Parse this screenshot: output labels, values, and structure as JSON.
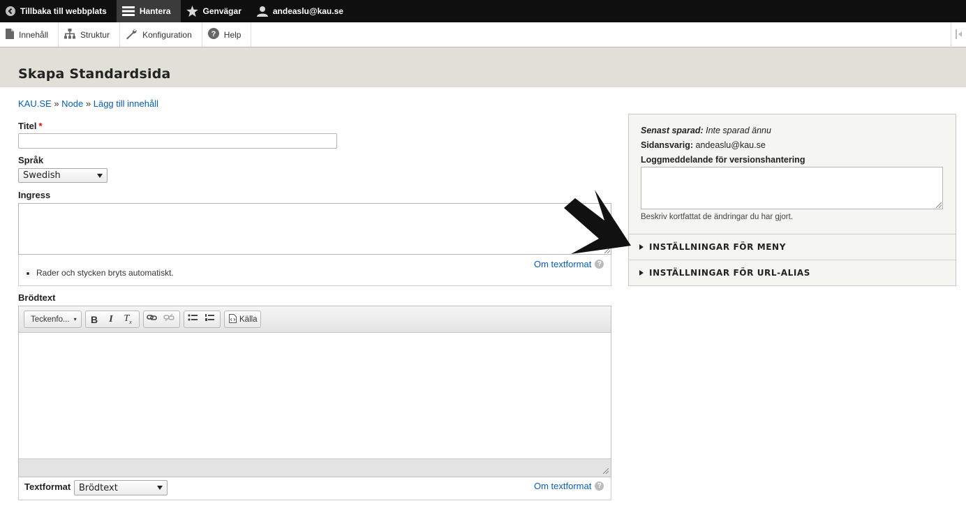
{
  "toolbar": {
    "back_label": "Tillbaka till webbplats",
    "manage_label": "Hantera",
    "shortcuts_label": "Genvägar",
    "user_label": "andeaslu@kau.se"
  },
  "tray": {
    "items": [
      {
        "label": "Innehåll"
      },
      {
        "label": "Struktur"
      },
      {
        "label": "Konfiguration"
      },
      {
        "label": "Help"
      }
    ]
  },
  "page": {
    "title": "Skapa Standardsida"
  },
  "breadcrumb": {
    "items": [
      "KAU.SE",
      "Node",
      "Lägg till innehåll"
    ],
    "separator": "»"
  },
  "form": {
    "title_label": "Titel",
    "required_mark": "*",
    "title_value": "",
    "language_label": "Språk",
    "language_value": "Swedish",
    "ingress_label": "Ingress",
    "ingress_value": "",
    "ingress_tip": "Rader och stycken bryts automatiskt.",
    "format_help_link": "Om textformat",
    "body_label": "Brödtext",
    "text_format_label": "Textformat",
    "text_format_value": "Brödtext"
  },
  "editor": {
    "font_select_label": "Teckenfo...",
    "source_label": "Källa",
    "buttons": [
      "bold",
      "italic",
      "remove-format",
      "link",
      "unlink",
      "bulleted-list",
      "numbered-list",
      "source"
    ]
  },
  "sidebar": {
    "last_saved_label": "Senast sparad:",
    "last_saved_value": "Inte sparad ännu",
    "owner_label": "Sidansvarig:",
    "owner_value": "andeaslu@kau.se",
    "log_label": "Loggmeddelande för versionshantering",
    "log_value": "",
    "log_description": "Beskriv kortfattat de ändringar du har gjort.",
    "menu_settings": "INSTÄLLNINGAR FÖR MENY",
    "url_alias_settings": "INSTÄLLNINGAR FÖR URL-ALIAS"
  },
  "colors": {
    "toolbar_bg": "#0f0f0f",
    "header_bg": "#e0e0d8",
    "link": "#0a5db0",
    "required": "#ee0000"
  }
}
